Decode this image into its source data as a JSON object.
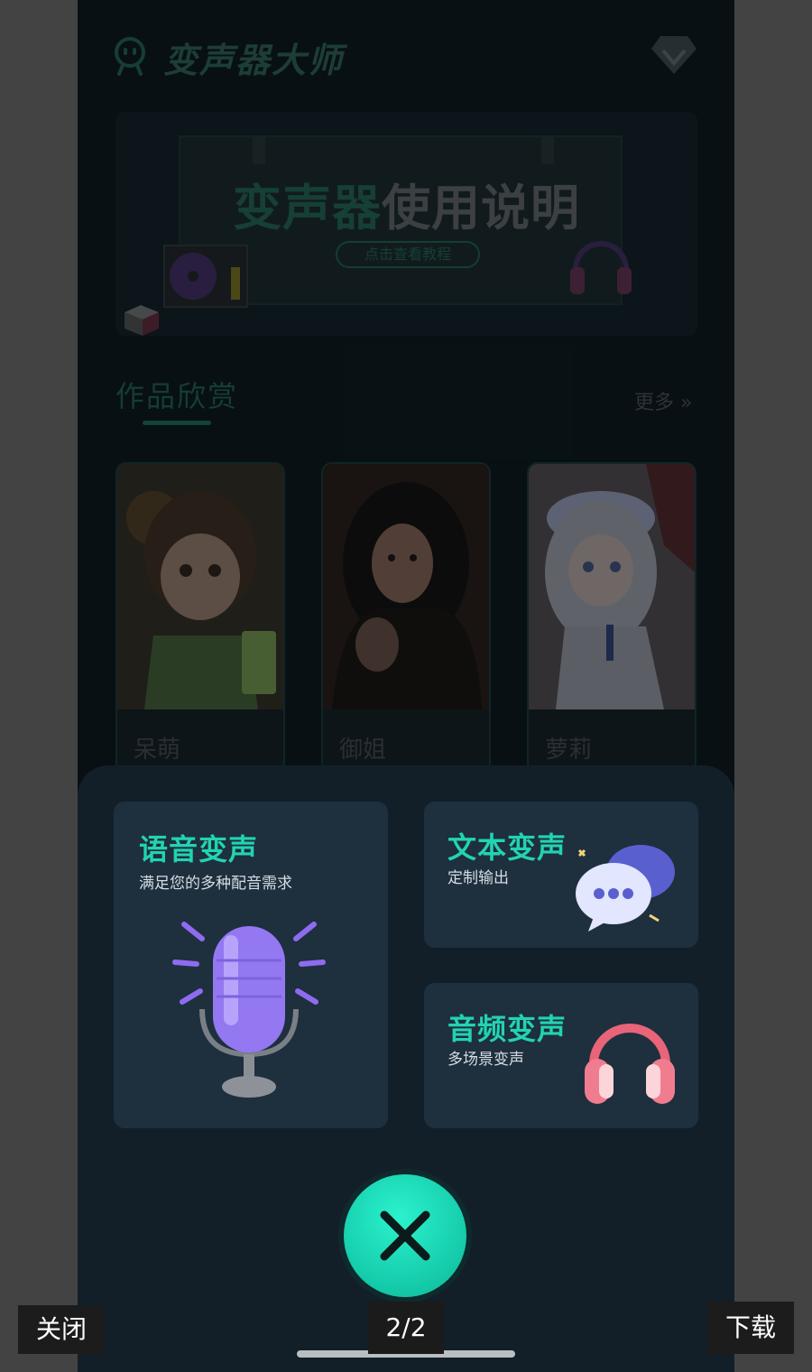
{
  "app": {
    "title": "变声器大师",
    "logo_icon": "robot-face-icon",
    "vip_icon": "diamond-vip-icon"
  },
  "banner": {
    "title_part1": "变声器",
    "title_part2": "使用说明",
    "button_label": "点击查看教程",
    "icons": [
      "record-player-icon",
      "headphones-icon",
      "cube-icon"
    ]
  },
  "works": {
    "section_title": "作品欣赏",
    "more_label": "更多 »",
    "items": [
      {
        "label": "呆萌",
        "image": "girl-drinking-tea-image"
      },
      {
        "label": "御姐",
        "image": "dark-haired-woman-image"
      },
      {
        "label": "萝莉",
        "image": "anime-girl-hat-image"
      }
    ]
  },
  "sheet": {
    "voice_change": {
      "title": "语音变声",
      "subtitle": "满足您的多种配音需求",
      "icon": "microphone-icon"
    },
    "text_change": {
      "title": "文本变声",
      "subtitle": "定制输出",
      "icon": "chat-bubbles-icon"
    },
    "audio_change": {
      "title": "音频变声",
      "subtitle": "多场景变声",
      "icon": "headphones-icon"
    },
    "close_icon": "close-x-icon"
  },
  "viewer": {
    "close_label": "关闭",
    "counter": "2/2",
    "download_label": "下载"
  },
  "colors": {
    "accent": "#22d3b2",
    "sheet_bg": "#121f29",
    "card_bg": "#1e2f3e"
  }
}
